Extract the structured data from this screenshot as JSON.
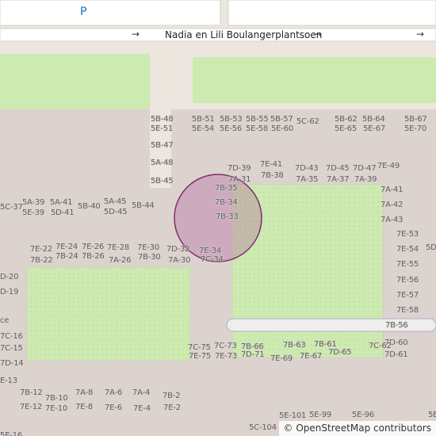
{
  "map": {
    "street_name": "Nadia en Lili Boulangerplantsoen",
    "parking_symbol": "P",
    "attribution": "© OpenStreetMap contributors",
    "colors": {
      "background": "#ebe6de",
      "block": "#dcd3cf",
      "grass": "#cdebb0",
      "road": "#ffffff",
      "circle_stroke": "#7b2f6e",
      "circle_fill": "#b45fa0",
      "parking": "#0a77c2"
    },
    "labels": [
      "5B-48",
      "5E-51",
      "5B-51",
      "5E-54",
      "5B-53",
      "5E-56",
      "5B-55",
      "5E-58",
      "5B-57",
      "5E-60",
      "5C-62",
      "5B-62",
      "5E-65",
      "5B-64",
      "5E-67",
      "5B-67",
      "5E-70",
      "5B-47",
      "5A-48",
      "5B-45",
      "7D-39",
      "7A-31",
      "7E-41",
      "7B-38",
      "7D-43",
      "7A-35",
      "7D-45",
      "7A-37",
      "7D-47",
      "7A-39",
      "7E-49",
      "7B-35",
      "7B-34",
      "7B-33",
      "7A-41",
      "7A-42",
      "7A-43",
      "5C-37",
      "5A-39",
      "5E-39",
      "5A-41",
      "5D-41",
      "5B-40",
      "5A-45",
      "5D-45",
      "5B-44",
      "7E-53",
      "7E-54",
      "7E-55",
      "7E-56",
      "7E-57",
      "7E-58",
      "7B-56",
      "7D-60",
      "7D-61",
      "7C-62",
      "7E-22",
      "7B-22",
      "7E-24",
      "7B-24",
      "7E-26",
      "7B-26",
      "7E-28",
      "7A-26",
      "7E-30",
      "7B-30",
      "7D-32",
      "7A-30",
      "7E-34",
      "7C-34",
      "D-20",
      "D-19",
      "ce",
      "7C-16",
      "7C-15",
      "7D-14",
      "E-13",
      "7B-12",
      "7E-12",
      "7B-10",
      "7E-10",
      "7A-8",
      "7E-8",
      "7A-6",
      "7E-6",
      "7A-4",
      "7E-4",
      "7B-2",
      "7E-2",
      "7C-75",
      "7E-75",
      "7C-73",
      "7E-73",
      "7B-66",
      "7D-71",
      "7B-63",
      "7E-69",
      "7B-61",
      "7E-67",
      "7D-65",
      "5E-101",
      "5E-99",
      "5E-96",
      "5C-104",
      "5E",
      "5D",
      "5E-16"
    ]
  }
}
